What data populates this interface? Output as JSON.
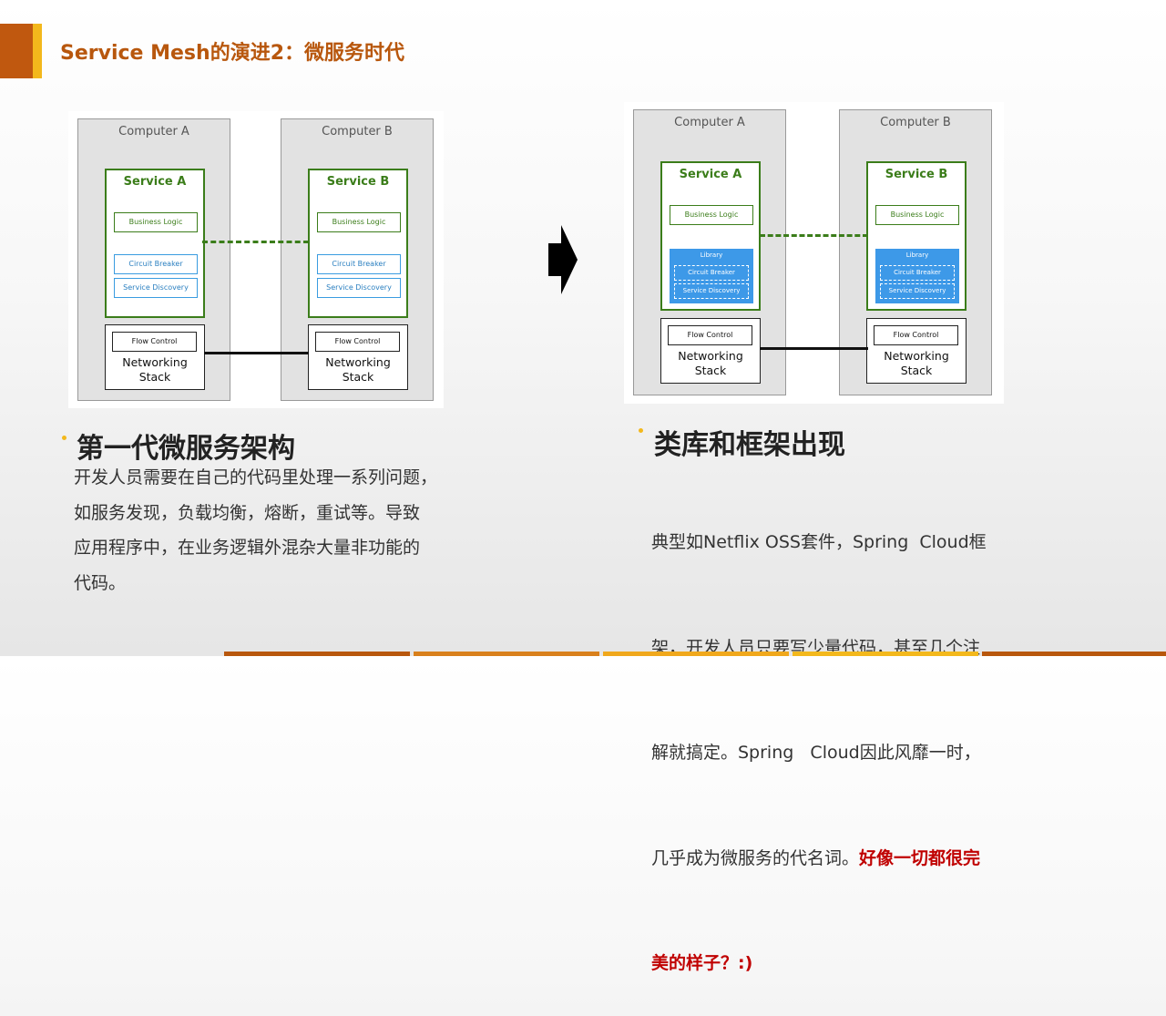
{
  "title": "Service Mesh的演进2：微服务时代",
  "diagram_left": {
    "computer_a": "Computer A",
    "computer_b": "Computer B",
    "service_a": "Service A",
    "service_b": "Service B",
    "business_logic": "Business Logic",
    "circuit_breaker": "Circuit Breaker",
    "service_discovery": "Service Discovery",
    "flow_control": "Flow Control",
    "networking_stack": "Networking Stack"
  },
  "diagram_right": {
    "computer_a": "Computer A",
    "computer_b": "Computer B",
    "service_a": "Service A",
    "service_b": "Service B",
    "business_logic": "Business Logic",
    "library": "Library",
    "circuit_breaker": "Circuit Breaker",
    "service_discovery": "Service Discovery",
    "flow_control": "Flow Control",
    "networking_stack": "Networking Stack"
  },
  "left_section": {
    "heading": "第一代微服务架构",
    "lines": [
      "开发人员需要在自己的代码里处理一系列问题，",
      "如服务发现，负载均衡，熔断，重试等。导致",
      "应用程序中，在业务逻辑外混杂大量非功能的",
      "代码。"
    ]
  },
  "right_section": {
    "heading": "类库和框架出现",
    "lines": [
      "典型如Netflix OSS套件，Spring  Cloud框",
      "架，开发人员只要写少量代码，甚至几个注",
      "解就搞定。Spring   Cloud因此风靡一时，",
      "几乎成为微服务的代名词。"
    ],
    "highlight_1": "好像一切都很完",
    "highlight_2": "美的样子？:)"
  },
  "colors": {
    "accent": "#c0580f",
    "stripe": "#f3b81c",
    "service_green": "#3b7d1a",
    "library_blue": "#3d99e8",
    "highlight_red": "#c00000"
  }
}
